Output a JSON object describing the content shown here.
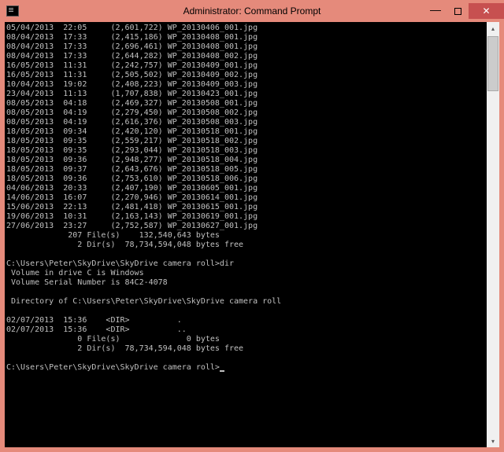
{
  "window": {
    "title": "Administrator: Command Prompt"
  },
  "console": {
    "file_listing": [
      {
        "date": "05/04/2013",
        "time": "22:05",
        "size": "(2,601,722)",
        "name": "WP_20130406_001.jpg"
      },
      {
        "date": "08/04/2013",
        "time": "17:33",
        "size": "(2,415,186)",
        "name": "WP_20130408_001.jpg"
      },
      {
        "date": "08/04/2013",
        "time": "17:33",
        "size": "(2,696,461)",
        "name": "WP_20130408_001.jpg"
      },
      {
        "date": "08/04/2013",
        "time": "17:33",
        "size": "(2,644,282)",
        "name": "WP_20130408_002.jpg"
      },
      {
        "date": "16/05/2013",
        "time": "11:31",
        "size": "(2,242,757)",
        "name": "WP_20130409_001.jpg"
      },
      {
        "date": "16/05/2013",
        "time": "11:31",
        "size": "(2,505,502)",
        "name": "WP_20130409_002.jpg"
      },
      {
        "date": "10/04/2013",
        "time": "19:02",
        "size": "(2,408,223)",
        "name": "WP_20130409_003.jpg"
      },
      {
        "date": "23/04/2013",
        "time": "11:13",
        "size": "(1,707,838)",
        "name": "WP_20130423_001.jpg"
      },
      {
        "date": "08/05/2013",
        "time": "04:18",
        "size": "(2,469,327)",
        "name": "WP_20130508_001.jpg"
      },
      {
        "date": "08/05/2013",
        "time": "04:19",
        "size": "(2,279,450)",
        "name": "WP_20130508_002.jpg"
      },
      {
        "date": "08/05/2013",
        "time": "04:19",
        "size": "(2,616,376)",
        "name": "WP_20130508_003.jpg"
      },
      {
        "date": "18/05/2013",
        "time": "09:34",
        "size": "(2,420,120)",
        "name": "WP_20130518_001.jpg"
      },
      {
        "date": "18/05/2013",
        "time": "09:35",
        "size": "(2,559,217)",
        "name": "WP_20130518_002.jpg"
      },
      {
        "date": "18/05/2013",
        "time": "09:35",
        "size": "(2,293,044)",
        "name": "WP_20130518_003.jpg"
      },
      {
        "date": "18/05/2013",
        "time": "09:36",
        "size": "(2,948,277)",
        "name": "WP_20130518_004.jpg"
      },
      {
        "date": "18/05/2013",
        "time": "09:37",
        "size": "(2,643,676)",
        "name": "WP_20130518_005.jpg"
      },
      {
        "date": "18/05/2013",
        "time": "09:36",
        "size": "(2,753,610)",
        "name": "WP_20130518_006.jpg"
      },
      {
        "date": "04/06/2013",
        "time": "20:33",
        "size": "(2,407,190)",
        "name": "WP_20130605_001.jpg"
      },
      {
        "date": "14/06/2013",
        "time": "16:07",
        "size": "(2,270,946)",
        "name": "WP_20130614_001.jpg"
      },
      {
        "date": "15/06/2013",
        "time": "22:13",
        "size": "(2,481,418)",
        "name": "WP_20130615_001.jpg"
      },
      {
        "date": "19/06/2013",
        "time": "10:31",
        "size": "(2,163,143)",
        "name": "WP_20130619_001.jpg"
      },
      {
        "date": "27/06/2013",
        "time": "23:27",
        "size": "(2,752,587)",
        "name": "WP_20130627_001.jpg"
      }
    ],
    "summary1_files": "             207 File(s)    132,540,643 bytes",
    "summary1_dirs": "               2 Dir(s)  78,734,594,048 bytes free",
    "blank1": "",
    "prompt1": "C:\\Users\\Peter\\SkyDrive\\SkyDrive camera roll>dir",
    "vol1": " Volume in drive C is Windows",
    "vol2": " Volume Serial Number is 84C2-4078",
    "blank2": "",
    "dirof": " Directory of C:\\Users\\Peter\\SkyDrive\\SkyDrive camera roll",
    "blank3": "",
    "dir_listing": [
      {
        "date": "02/07/2013",
        "time": "15:36",
        "marker": "<DIR>",
        "name": "."
      },
      {
        "date": "02/07/2013",
        "time": "15:36",
        "marker": "<DIR>",
        "name": ".."
      }
    ],
    "summary2_files": "               0 File(s)              0 bytes",
    "summary2_dirs": "               2 Dir(s)  78,734,594,048 bytes free",
    "blank4": "",
    "prompt2": "C:\\Users\\Peter\\SkyDrive\\SkyDrive camera roll>"
  }
}
